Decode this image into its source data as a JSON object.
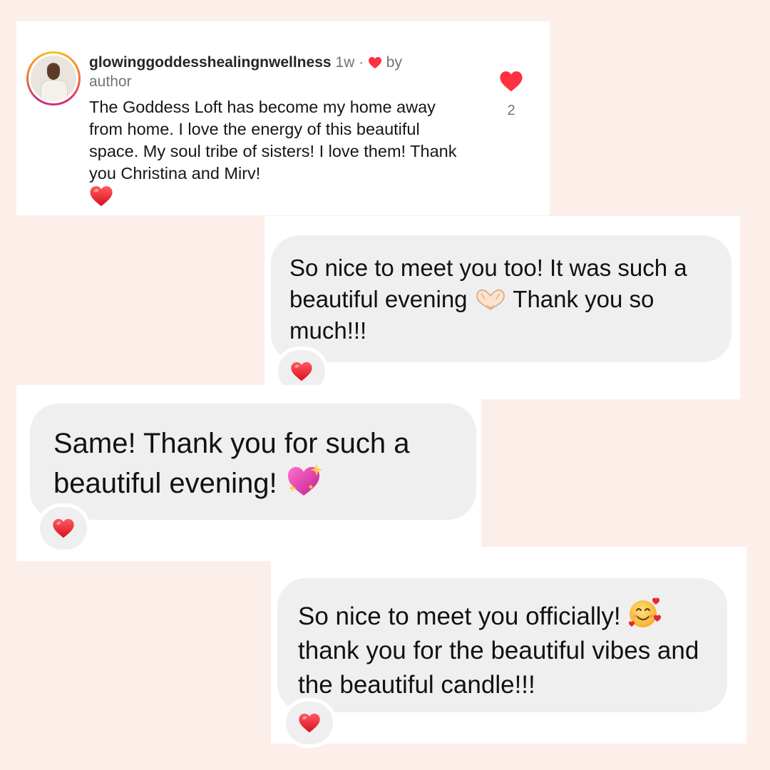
{
  "comment": {
    "username": "glowinggoddesshealingnwellness",
    "time": "1w",
    "separator": "·",
    "liked_by": "by author",
    "text": "The Goddess Loft has become my home away from home. I love the energy of this beautiful space. My soul tribe of sisters! I love them! Thank you Christina and Mirv!",
    "like_count": "2"
  },
  "messages": [
    {
      "text_before": "So nice to meet you too! It was such a beautiful evening",
      "emoji": "heart-hands-emoji",
      "text_after": "Thank you so much!!!",
      "reaction": "red-heart-emoji"
    },
    {
      "text_before": "Same! Thank you for such a beautiful evening!",
      "emoji": "sparkling-heart-emoji",
      "reaction": "red-heart-emoji"
    },
    {
      "text_before": "So nice to meet you officially!",
      "emoji": "smiling-face-with-hearts-emoji",
      "text_after": "thank you for the beautiful vibes and the beautiful candle!!!",
      "reaction": "red-heart-emoji"
    }
  ],
  "colors": {
    "background": "#fcefea",
    "bubble": "#efefef",
    "heart": "#ff3040",
    "muted_text": "#737373"
  }
}
